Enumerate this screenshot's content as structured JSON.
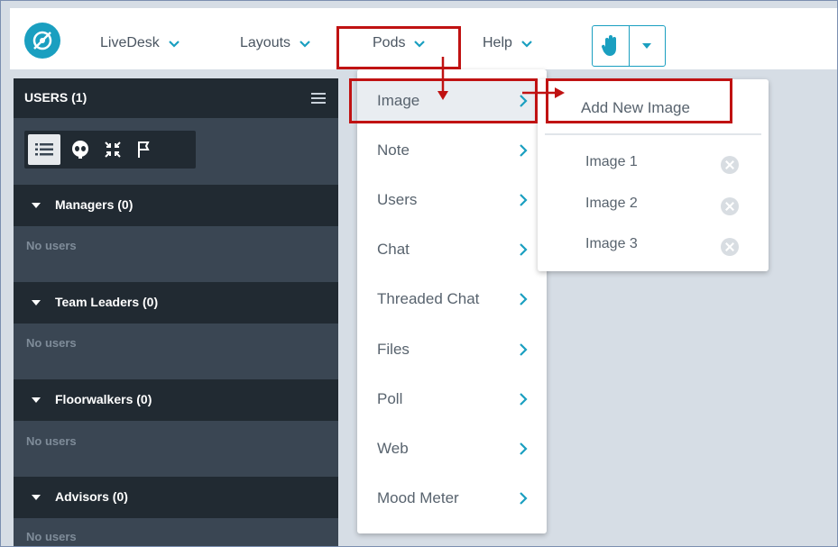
{
  "nav": {
    "items": [
      {
        "label": "LiveDesk"
      },
      {
        "label": "Layouts"
      },
      {
        "label": "Pods"
      },
      {
        "label": "Help"
      }
    ]
  },
  "users_panel": {
    "title": "USERS (1)",
    "groups": [
      {
        "label": "Managers (0)",
        "empty": "No users"
      },
      {
        "label": "Team Leaders (0)",
        "empty": "No users"
      },
      {
        "label": "Floorwalkers (0)",
        "empty": "No users"
      },
      {
        "label": "Advisors (0)",
        "empty": "No users"
      }
    ]
  },
  "pods_menu": {
    "items": [
      {
        "label": "Image"
      },
      {
        "label": "Note"
      },
      {
        "label": "Users"
      },
      {
        "label": "Chat"
      },
      {
        "label": "Threaded Chat"
      },
      {
        "label": "Files"
      },
      {
        "label": "Poll"
      },
      {
        "label": "Web"
      },
      {
        "label": "Mood Meter"
      }
    ]
  },
  "image_submenu": {
    "add_label": "Add New Image",
    "items": [
      {
        "label": "Image 1"
      },
      {
        "label": "Image 2"
      },
      {
        "label": "Image 3"
      }
    ]
  },
  "colors": {
    "accent": "#1a9fc0",
    "annotation": "#c01212",
    "panel_dark": "#212a32",
    "panel": "#3a4653"
  }
}
